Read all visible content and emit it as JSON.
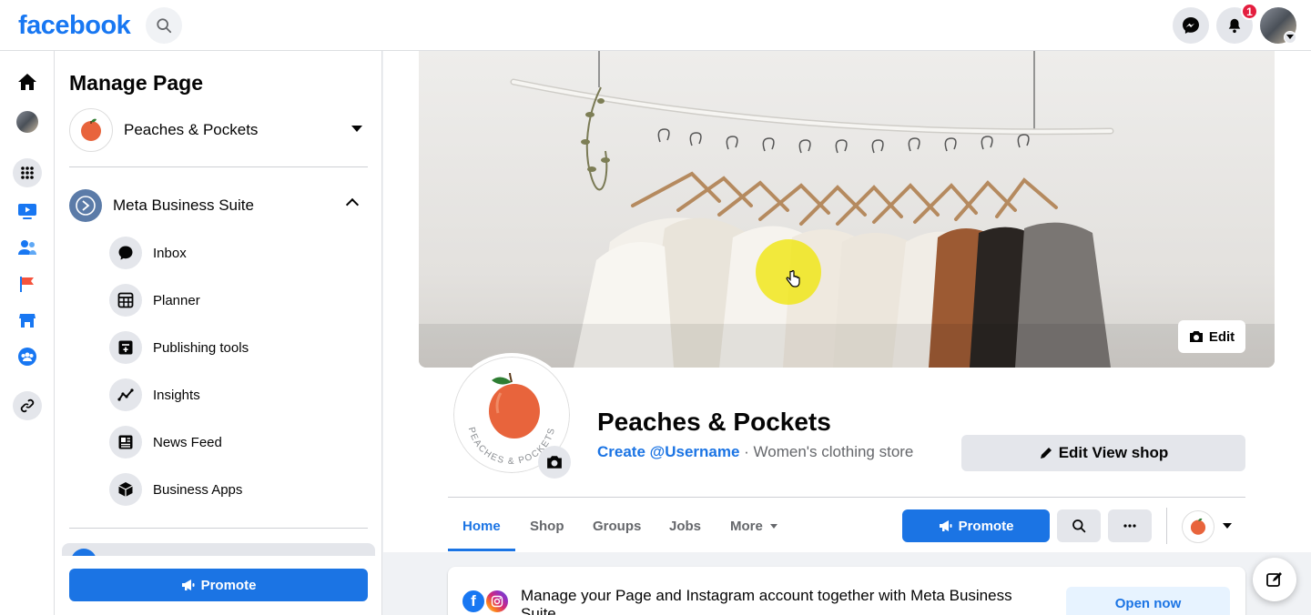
{
  "topbar": {
    "logo": "facebook",
    "notifications_count": "1"
  },
  "rail": {
    "icons": [
      "home-icon",
      "profile-avatar",
      "menu-grid-icon",
      "watch-icon",
      "friends-icon",
      "pages-flag-icon",
      "marketplace-icon",
      "groups-icon",
      "link-icon"
    ]
  },
  "panel": {
    "title": "Manage Page",
    "page_name": "Peaches & Pockets",
    "suite_label": "Meta Business Suite",
    "items": [
      {
        "label": "Inbox",
        "icon": "chat-bubble-icon"
      },
      {
        "label": "Planner",
        "icon": "calendar-grid-icon"
      },
      {
        "label": "Publishing tools",
        "icon": "publishing-tools-icon"
      },
      {
        "label": "Insights",
        "icon": "insights-chart-icon"
      },
      {
        "label": "News Feed",
        "icon": "news-feed-icon"
      },
      {
        "label": "Business Apps",
        "icon": "cube-icon"
      }
    ],
    "promote_label": "Promote"
  },
  "cover": {
    "edit_label": "Edit"
  },
  "profile": {
    "name": "Peaches & Pockets",
    "username_link": "Create @Username",
    "separator": " · ",
    "category": "Women's clothing store",
    "edit_shop_label": "Edit View shop",
    "logo_text": "PEACHES & POCKETS"
  },
  "tabs": [
    {
      "label": "Home"
    },
    {
      "label": "Shop"
    },
    {
      "label": "Groups"
    },
    {
      "label": "Jobs"
    },
    {
      "label": "More"
    }
  ],
  "actions": {
    "promote_label": "Promote"
  },
  "notice": {
    "text": "Manage your Page and Instagram account together with Meta Business Suite",
    "button_label": "Open now"
  },
  "colors": {
    "brand_blue": "#1877f2",
    "button_blue": "#1b74e4",
    "badge_red": "#e41e3f",
    "peach": "#e8643c"
  }
}
